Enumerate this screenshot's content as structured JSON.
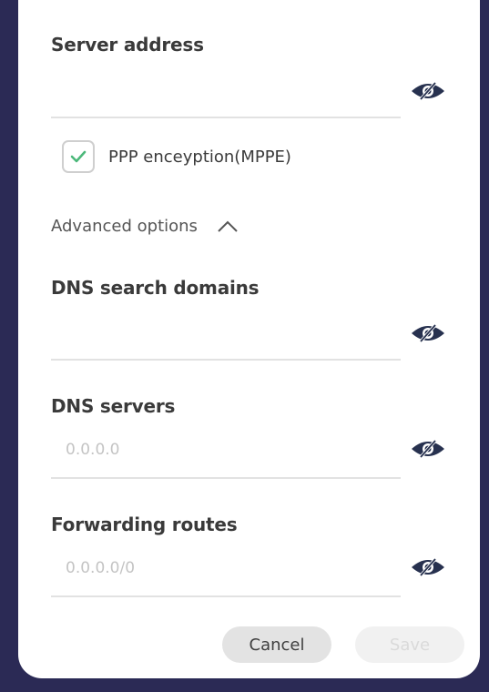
{
  "server": {
    "title": "Server address",
    "value": "",
    "placeholder": ""
  },
  "encryption": {
    "label": "PPP enceyption(MPPE)",
    "checked": true
  },
  "advanced": {
    "label": "Advanced options",
    "expanded": true
  },
  "dns_domains": {
    "title": "DNS search domains",
    "value": "",
    "placeholder": ""
  },
  "dns_servers": {
    "title": "DNS servers",
    "value": "",
    "placeholder": "0.0.0.0"
  },
  "routes": {
    "title": "Forwarding routes",
    "value": "",
    "placeholder": "0.0.0.0/0"
  },
  "buttons": {
    "cancel": "Cancel",
    "save": "Save"
  },
  "colors": {
    "backdrop": "#2b2a55",
    "check": "#4cb87a",
    "icon": "#27314f"
  },
  "icons": {
    "visibility_toggle": "eye-slash-icon",
    "check": "check-icon",
    "expand": "chevron-up-icon"
  }
}
